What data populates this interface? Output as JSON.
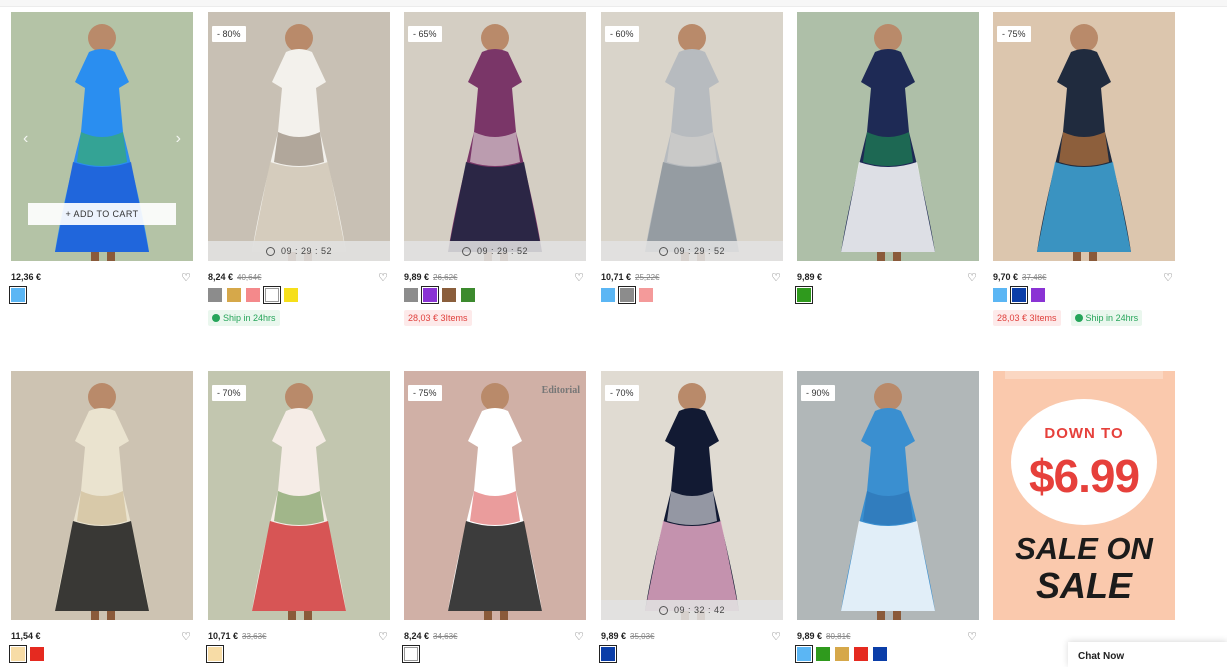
{
  "timer_glyph": "◷",
  "products": [
    {
      "price": "12,36 €",
      "old_price": "",
      "discount": "",
      "timer": "",
      "add_to_cart": "+ ADD TO CART",
      "prev_arrow": "‹",
      "next_arrow": "›",
      "swatches": [
        "#5bb6f4"
      ],
      "selected": 0,
      "tags": [],
      "palette": [
        "#2a8ef0",
        "#1e5fd8",
        "#3cb44a",
        "#e8302c",
        "#f3b61f"
      ]
    },
    {
      "price": "8,24 €",
      "old_price": "40,64€",
      "discount": "- 80%",
      "timer": "09 : 29 : 52",
      "swatches": [
        "#8c8c8c",
        "#d6a84a",
        "#f4898b",
        "#ffffff",
        "#f6df1a"
      ],
      "selected": 3,
      "tags": [
        {
          "type": "green",
          "text": "Ship in 24hrs"
        }
      ],
      "palette": [
        "#f3f1ec",
        "#cfc6b5",
        "#7a6a5a"
      ]
    },
    {
      "price": "9,89 €",
      "old_price": "26,62€",
      "discount": "- 65%",
      "timer": "09 : 29 : 52",
      "swatches": [
        "#8c8c8c",
        "#8a33d4",
        "#8a5e3c",
        "#3c8a2e"
      ],
      "selected": 1,
      "tags": [
        {
          "type": "red",
          "text": "28,03 € 3Items"
        }
      ],
      "palette": [
        "#7a3668",
        "#1d2340",
        "#f1f0ea"
      ]
    },
    {
      "price": "10,71 €",
      "old_price": "25,22€",
      "discount": "- 60%",
      "timer": "09 : 29 : 52",
      "swatches": [
        "#5bb6f4",
        "#8c8c8c",
        "#f49a9a"
      ],
      "selected": 1,
      "tags": [],
      "palette": [
        "#b7bbbf",
        "#8f969c",
        "#d8d6d0"
      ]
    },
    {
      "price": "9,89 €",
      "old_price": "",
      "discount": "",
      "timer": "",
      "swatches": [
        "#2f9a1d"
      ],
      "selected": 0,
      "tags": [],
      "palette": [
        "#1e2a55",
        "#ffffff",
        "#1e9a52"
      ]
    },
    {
      "price": "9,70 €",
      "old_price": "37,48€",
      "discount": "- 75%",
      "timer": "",
      "swatches": [
        "#5bb6f4",
        "#0b3ea8",
        "#8a33d4"
      ],
      "selected": 1,
      "tags": [
        {
          "type": "red",
          "text": "28,03 € 3Items"
        },
        {
          "type": "green",
          "text": "Ship in 24hrs"
        }
      ],
      "palette": [
        "#202b3e",
        "#3fa6d8",
        "#e78a3a"
      ]
    },
    {
      "price": "11,54 €",
      "old_price": "",
      "discount": "",
      "timer": "",
      "swatches": [
        "#f7dca6",
        "#e52a20"
      ],
      "selected": 0,
      "tags": [],
      "palette": [
        "#eae3cf",
        "#1a1a1a",
        "#c8b48a"
      ]
    },
    {
      "price": "10,71 €",
      "old_price": "33,63€",
      "discount": "- 70%",
      "timer": "",
      "swatches": [
        "#f7dca6"
      ],
      "selected": 0,
      "tags": [],
      "palette": [
        "#f5ece6",
        "#d13b3b",
        "#5b8a3e"
      ]
    },
    {
      "price": "8,24 €",
      "old_price": "34,63€",
      "discount": "- 75%",
      "timer": "",
      "editorial": "Editorial",
      "swatches": [
        "#ffffff"
      ],
      "selected": 0,
      "tags": [],
      "palette": [
        "#ffffff",
        "#1a1a1a",
        "#d94a4a"
      ]
    },
    {
      "price": "9,89 €",
      "old_price": "35,03€",
      "discount": "- 70%",
      "timer": "09 : 32 : 42",
      "swatches": [
        "#0b3ea8"
      ],
      "selected": 0,
      "tags": [],
      "palette": [
        "#121a33",
        "#e4a8c4",
        "#ffffff"
      ]
    },
    {
      "price": "9,89 €",
      "old_price": "80,81€",
      "discount": "- 90%",
      "timer": "",
      "swatches": [
        "#5bb6f4",
        "#2f9a1d",
        "#d6a84a",
        "#e52a20",
        "#0b3ea8"
      ],
      "selected": 0,
      "tags": [],
      "palette": [
        "#3a8fd0",
        "#ffffff",
        "#2a6fae"
      ]
    }
  ],
  "promo": {
    "line1": "DOWN TO",
    "amount": "$6.99",
    "line2": "SALE ON",
    "line3": "SALE"
  },
  "chat": {
    "label": "Chat Now"
  },
  "colors": {
    "accent_red": "#e6403b",
    "ship_green": "#26a55a"
  }
}
